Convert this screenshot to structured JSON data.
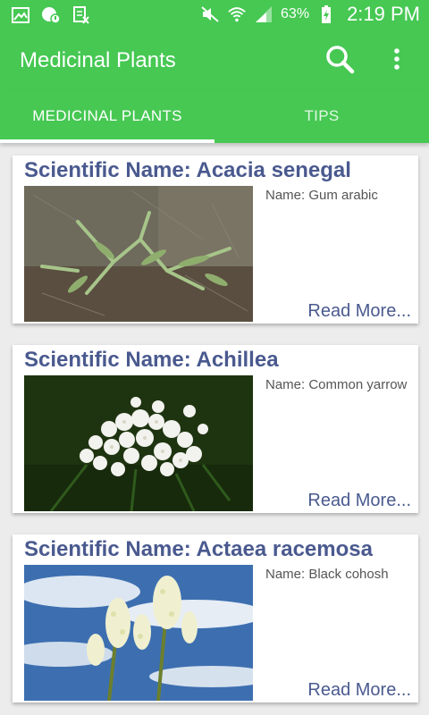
{
  "status_bar": {
    "battery": "63%",
    "time": "2:19 PM"
  },
  "app_bar": {
    "title": "Medicinal Plants"
  },
  "tabs": [
    {
      "label": "MEDICINAL PLANTS",
      "selected": true
    },
    {
      "label": "TIPS",
      "selected": false
    }
  ],
  "colors": {
    "primary": "#46c853",
    "title_text": "#4a5a8f"
  },
  "plants": [
    {
      "title": "Scientific Name: Acacia senegal",
      "name": "Name: Gum arabic",
      "more": "Read More..."
    },
    {
      "title": "Scientific Name: Achillea",
      "name": "Name: Common yarrow",
      "more": "Read More..."
    },
    {
      "title": "Scientific Name: Actaea racemosa",
      "name": "Name: Black cohosh",
      "more": "Read More..."
    }
  ]
}
